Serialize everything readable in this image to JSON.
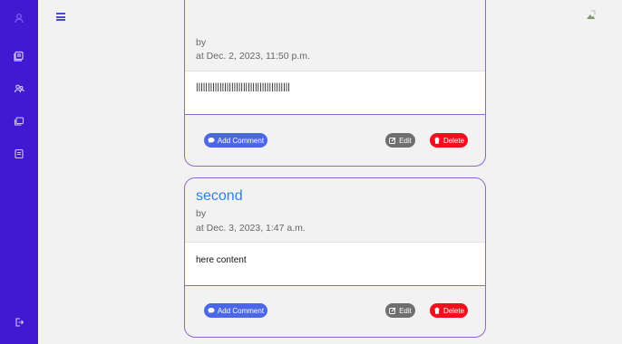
{
  "sidebar": {
    "icons": [
      "user-icon",
      "books-icon",
      "users-icon",
      "collection-icon",
      "notes-icon",
      "logout-icon"
    ],
    "accent": "#4318d1"
  },
  "posts": [
    {
      "title": "",
      "by": "by",
      "date": "at Dec. 2, 2023, 11:50 p.m.",
      "content": "||||||||||||||||||||||||||||||||||||||||",
      "buttons": {
        "comment": "Add Comment",
        "edit": "Edit",
        "delete": "Delete"
      }
    },
    {
      "title": "second",
      "by": "by",
      "date": "at Dec. 3, 2023, 1:47 a.m.",
      "content": "here content",
      "buttons": {
        "comment": "Add Comment",
        "edit": "Edit",
        "delete": "Delete"
      }
    }
  ],
  "colors": {
    "comment": "#4b67e8",
    "edit": "#6f6f6f",
    "delete": "#f20f1d",
    "title": "#2f7fe6",
    "border": "#8c6ac9"
  }
}
